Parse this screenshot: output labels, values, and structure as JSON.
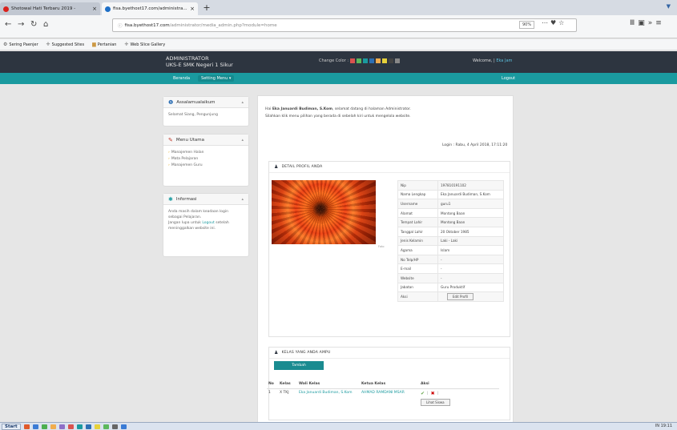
{
  "browser": {
    "tabs": [
      {
        "label": "Shotowal Hati Terbaru 2019 - ",
        "color": "#d9211c"
      },
      {
        "label": "fisa.byethost17.com/administra...",
        "color": "#1e6fc7"
      }
    ],
    "new_tab": "+",
    "url_host": "fisa.byethost17.com",
    "url_path": "/administrator/media_admin.php?module=home",
    "zoom": "90%",
    "bookmarks": [
      "Sering Paenjer",
      "Suggested Sites",
      "Pertanian",
      "Web Slice Gallery"
    ]
  },
  "header": {
    "line1": "ADMINISTRATOR",
    "line2": "UKS-E SMK Negeri 1 Sikur",
    "change_color": "Change Color :",
    "swatches": [
      "#d9534f",
      "#5cb85c",
      "#1a9a9f",
      "#2d6fb4",
      "#f0ad4e",
      "#e6d13a",
      "#444444",
      "#888888"
    ],
    "welcome": "Welcome,",
    "welcome_name": "Eka Jam"
  },
  "menu": {
    "items": [
      "Beranda",
      "Setting Menu"
    ],
    "logout": "Logout"
  },
  "sidebar": {
    "assalamu": {
      "title": "Assalamualaikum",
      "body": "Selamat Siang, Pengunjung"
    },
    "menu_utama": {
      "title": "Menu Utama",
      "items": [
        "Manajemen Halan",
        "Mata Pelajaran",
        "Manajemen Guru"
      ]
    },
    "informasi": {
      "title": "Informasi",
      "text1": "Anda masih dalam keadaan login sebagai Pelajaran.",
      "text2a": "Jangan lupa untuk",
      "link": "Logout",
      "text2b": "setelah meninggalkan website ini."
    }
  },
  "main": {
    "greeting_pre": "Hai",
    "greeting_name": "Eka Januardi Budiman, S.Kom",
    "greeting_post": ", selamat datang di halaman Administrator.",
    "instruction": "Silahkan klik menu pilihan yang berada di sebelah kiri untuk mengelola website.",
    "login_info": "Login : Rabu, 4 April 2018, 17:11:20",
    "profile_title": "DETAIL PROFIL ANDA",
    "photo_caption": "Foto",
    "profile": [
      {
        "label": "Nip",
        "value": "197810191102"
      },
      {
        "label": "Nama Lengkap",
        "value": "Eka Januardi Budiman, S.Kom"
      },
      {
        "label": "Username",
        "value": "guru1"
      },
      {
        "label": "Alamat",
        "value": "Montong Baan"
      },
      {
        "label": "Tempat Lahir",
        "value": "Montong Baan"
      },
      {
        "label": "Tanggal Lahir",
        "value": "20 Oktober 1985"
      },
      {
        "label": "Jenis Kelamin",
        "value": "Laki - Laki"
      },
      {
        "label": "Agama",
        "value": "Islam"
      },
      {
        "label": "No Telp/HP",
        "value": "-"
      },
      {
        "label": "E-mail",
        "value": "-"
      },
      {
        "label": "Website",
        "value": "-"
      },
      {
        "label": "Jabatan",
        "value": "Guru Produktif"
      },
      {
        "label": "Aksi",
        "value": ""
      }
    ],
    "edit_btn": "Edit Profil",
    "class_title": "KELAS YANG ANDA AMPU",
    "tambah": "Tambah",
    "class_headers": [
      "No",
      "Kelas",
      "Wali Kelas",
      "Ketua Kelas",
      "Aksi"
    ],
    "class_rows": [
      {
        "no": "1",
        "kelas": "X TKJ",
        "wali": "Eka Januardi Budiman, S.Kom",
        "ketua": "AHMAD RAMDANI MSAR",
        "lihat": "Lihat Siswa"
      }
    ]
  },
  "taskbar": {
    "start": "Start",
    "tray": "IN  19:11"
  }
}
